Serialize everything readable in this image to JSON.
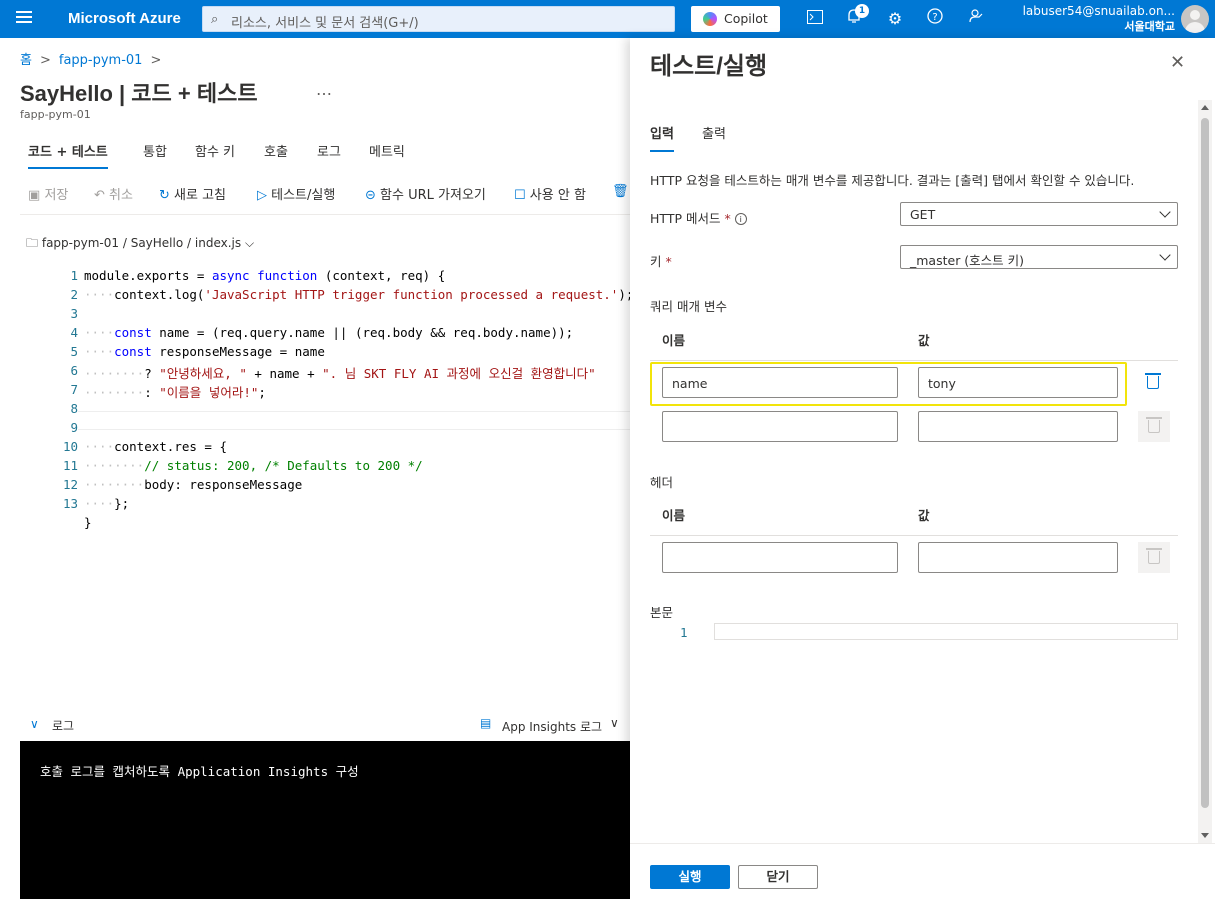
{
  "topbar": {
    "brand": "Microsoft Azure",
    "search_placeholder": "리소스, 서비스 및 문서 검색(G+/)",
    "copilot": "Copilot",
    "notification_count": "1",
    "user_email": "labuser54@snuailab.on...",
    "user_org": "서울대학교"
  },
  "breadcrumb": {
    "home": "홈",
    "resource": "fapp-pym-01",
    "separator": ">"
  },
  "page": {
    "title": "SayHello | 코드 + 테스트",
    "more": "…",
    "subtitle": "fapp-pym-01"
  },
  "tabs": [
    "코드 + 테스트",
    "통합",
    "함수 키",
    "호출",
    "로그",
    "메트릭"
  ],
  "toolbar": {
    "save": "저장",
    "discard": "취소",
    "refresh": "새로 고침",
    "test_run": "테스트/실행",
    "get_url": "함수 URL 가져오기",
    "disable": "사용 안 함"
  },
  "filepath": {
    "app": "fapp-pym-01",
    "function": "SayHello",
    "file": "index.js",
    "sep": "/"
  },
  "code": {
    "line_numbers": [
      "1",
      "2",
      "3",
      "4",
      "5",
      "6",
      "7",
      "8",
      "9",
      "10",
      "11",
      "12",
      "13"
    ]
  },
  "log": {
    "label": "로그",
    "insights": "App Insights 로그",
    "message": "호출 로그를 캡처하도록 Application Insights 구성"
  },
  "panel": {
    "title": "테스트/실행",
    "tab_input": "입력",
    "tab_output": "출력",
    "description": "HTTP 요청을 테스트하는 매개 변수를 제공합니다. 결과는 [출력] 탭에서 확인할 수 있습니다.",
    "http_method_label": "HTTP 메서드",
    "http_method_value": "GET",
    "key_label": "키",
    "key_value": "_master (호스트 키)",
    "required_mark": "*",
    "query_label": "쿼리 매개 변수",
    "col_name": "이름",
    "col_value": "값",
    "query_rows": [
      {
        "name": "name",
        "value": "tony"
      },
      {
        "name": "",
        "value": ""
      }
    ],
    "header_label": "헤더",
    "header_rows": [
      {
        "name": "",
        "value": ""
      }
    ],
    "body_label": "본문",
    "body_line": "1",
    "run_button": "실행",
    "close_button": "닫기"
  },
  "colors": {
    "accent": "#0078d4",
    "highlight": "#f2e40a"
  }
}
